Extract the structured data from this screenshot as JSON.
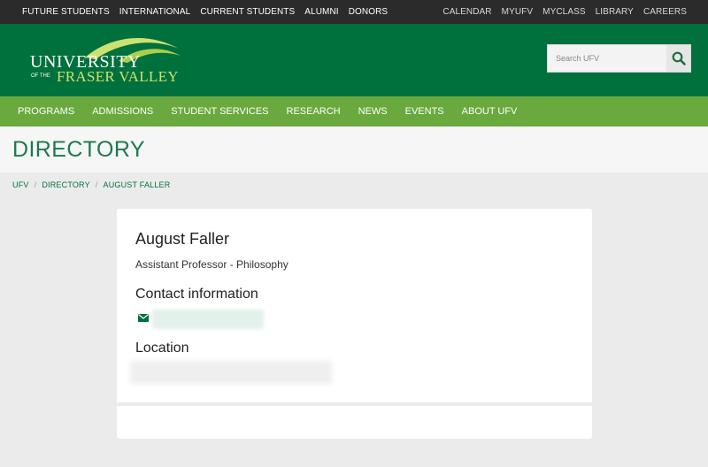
{
  "topbar": {
    "left": [
      "FUTURE STUDENTS",
      "INTERNATIONAL",
      "CURRENT STUDENTS",
      "ALUMNI",
      "DONORS"
    ],
    "right": [
      "CALENDAR",
      "MYUFV",
      "MYCLASS",
      "LIBRARY",
      "CAREERS"
    ]
  },
  "logo": {
    "line1": "UNIVERSITY",
    "line2a": "OF THE",
    "line2b": "FRASER VALLEY"
  },
  "search": {
    "placeholder": "Search UFV"
  },
  "nav": [
    "PROGRAMS",
    "ADMISSIONS",
    "STUDENT SERVICES",
    "RESEARCH",
    "NEWS",
    "EVENTS",
    "ABOUT UFV"
  ],
  "page_title": "DIRECTORY",
  "breadcrumb": [
    "UFV",
    "DIRECTORY",
    "AUGUST FALLER"
  ],
  "profile": {
    "name": "August Faller",
    "title": "Assistant Professor - Philosophy",
    "contact_heading": "Contact information",
    "location_heading": "Location"
  },
  "colors": {
    "topbar": "#2b2b2b",
    "brand_green": "#00703c",
    "nav_green": "#6aa93d",
    "leaf": "#cce26f"
  }
}
